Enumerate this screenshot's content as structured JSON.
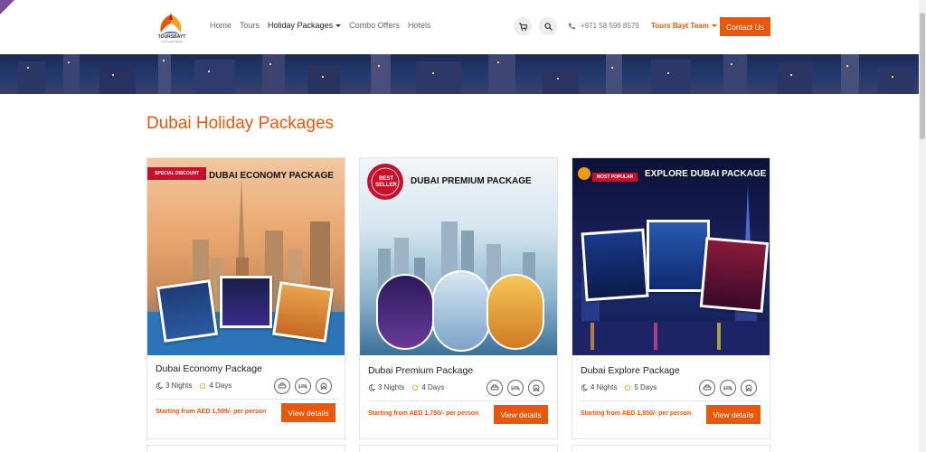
{
  "header": {
    "logo_text": "TOURSBAYT",
    "logo_tagline": "Tours and Travels",
    "nav": [
      {
        "label": "Home"
      },
      {
        "label": "Tours"
      },
      {
        "label": "Holiday Packages"
      },
      {
        "label": "Combo Offers"
      },
      {
        "label": "Hotels"
      }
    ],
    "phone": "+971 58 596 8579",
    "team": "Tours Bayt Team",
    "contact": "Contact Us"
  },
  "section": {
    "title": "Dubai Holiday Packages"
  },
  "cards": [
    {
      "image_title": "DUBAI ECONOMY PACKAGE",
      "badge": "SPECIAL DISCOUNT",
      "name": "Dubai Economy Package",
      "nights": "3 Nights",
      "days": "4 Days",
      "price": "Starting from AED 1,599/- per person",
      "button": "View details"
    },
    {
      "image_title": "DUBAI PREMIUM PACKAGE",
      "badge": "BEST SELLER",
      "name": "Dubai Premium Package",
      "nights": "3 Nights",
      "days": "4 Days",
      "price": "Starting from AED  1,750/- per person",
      "button": "View details"
    },
    {
      "image_title": "EXPLORE DUBAI PACKAGE",
      "badge": "MOST POPULAR",
      "name": "Dubai Explore Package",
      "nights": "4 Nights",
      "days": "5 Days",
      "price": "Starting from AED 1,850/- per person",
      "button": "View details"
    }
  ],
  "colors": {
    "accent": "#e8580c"
  }
}
